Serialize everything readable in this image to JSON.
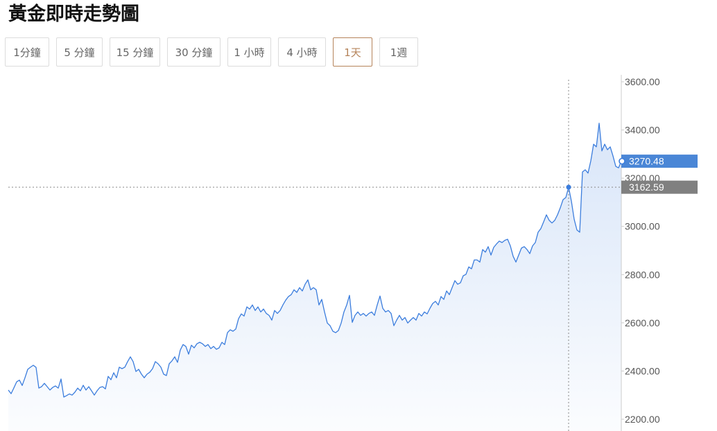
{
  "title": "黃金即時走勢圖",
  "tabs": [
    {
      "label": "1分鐘",
      "selected": false
    },
    {
      "label": "5 分鐘",
      "selected": false
    },
    {
      "label": "15 分鐘",
      "selected": false
    },
    {
      "label": "30 分鐘",
      "selected": false
    },
    {
      "label": "1 小時",
      "selected": false
    },
    {
      "label": "4 小時",
      "selected": false
    },
    {
      "label": "1天",
      "selected": true
    },
    {
      "label": "1週",
      "selected": false
    }
  ],
  "colors": {
    "selected_tab": "#b5835a",
    "tab_border": "#dcdcdc"
  },
  "chart_data": {
    "type": "area",
    "y_axis_position": "right",
    "grid": false,
    "ylim": [
      2200,
      3600
    ],
    "yticks": [
      3600,
      3400,
      3200,
      3000,
      2800,
      2600,
      2400,
      2200
    ],
    "ytick_labels": [
      "3600.00",
      "3400.00",
      "3200.00",
      "3000.00",
      "2800.00",
      "2600.00",
      "2400.00",
      "2200.00"
    ],
    "last_price_label": "3270.48",
    "crosshair_label": "3162.59",
    "line_color": "#3b7ddd",
    "last_price_color": "#4a86d6",
    "crosshair_label_color": "#808080",
    "values": [
      2321,
      2306,
      2330,
      2355,
      2362,
      2340,
      2372,
      2407,
      2416,
      2424,
      2415,
      2329,
      2335,
      2349,
      2335,
      2321,
      2332,
      2338,
      2329,
      2367,
      2292,
      2298,
      2305,
      2300,
      2312,
      2329,
      2318,
      2341,
      2321,
      2335,
      2318,
      2300,
      2318,
      2332,
      2335,
      2326,
      2378,
      2364,
      2393,
      2372,
      2416,
      2410,
      2416,
      2439,
      2459,
      2439,
      2398,
      2407,
      2387,
      2372,
      2387,
      2395,
      2410,
      2439,
      2430,
      2416,
      2387,
      2381,
      2430,
      2442,
      2459,
      2436,
      2487,
      2510,
      2502,
      2470,
      2507,
      2496,
      2513,
      2519,
      2513,
      2502,
      2510,
      2493,
      2502,
      2490,
      2496,
      2519,
      2510,
      2559,
      2571,
      2565,
      2574,
      2617,
      2637,
      2628,
      2666,
      2657,
      2674,
      2651,
      2666,
      2645,
      2657,
      2639,
      2631,
      2611,
      2651,
      2639,
      2651,
      2674,
      2694,
      2709,
      2717,
      2737,
      2726,
      2746,
      2732,
      2760,
      2778,
      2737,
      2746,
      2737,
      2674,
      2697,
      2645,
      2599,
      2588,
      2565,
      2559,
      2568,
      2599,
      2645,
      2674,
      2714,
      2602,
      2631,
      2645,
      2631,
      2639,
      2628,
      2639,
      2645,
      2631,
      2674,
      2711,
      2660,
      2645,
      2651,
      2639,
      2588,
      2611,
      2631,
      2611,
      2622,
      2599,
      2611,
      2622,
      2611,
      2639,
      2628,
      2645,
      2637,
      2660,
      2680,
      2689,
      2674,
      2709,
      2697,
      2732,
      2717,
      2746,
      2775,
      2760,
      2766,
      2795,
      2801,
      2832,
      2824,
      2861,
      2861,
      2852,
      2904,
      2893,
      2916,
      2881,
      2913,
      2927,
      2939,
      2933,
      2942,
      2947,
      2919,
      2876,
      2852,
      2881,
      2910,
      2916,
      2904,
      2887,
      2919,
      2933,
      2976,
      2991,
      3019,
      3048,
      3025,
      3014,
      3025,
      3048,
      3077,
      3111,
      3120,
      3162.59,
      3105,
      3030,
      2985,
      2976,
      3226,
      3235,
      3221,
      3272,
      3341,
      3330,
      3428,
      3313,
      3341,
      3318,
      3330,
      3292,
      3249,
      3243,
      3270.48
    ]
  }
}
